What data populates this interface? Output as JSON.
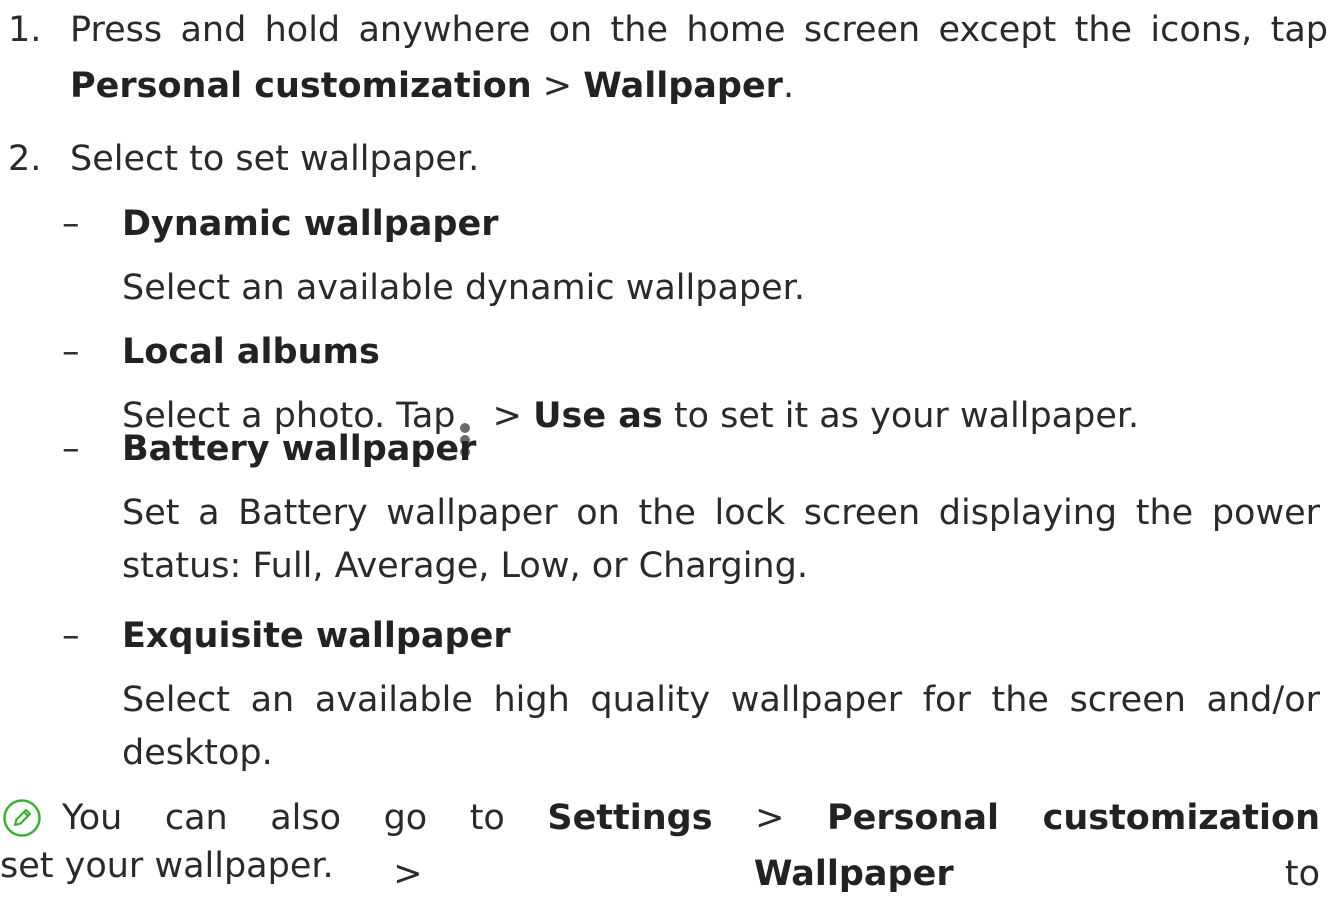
{
  "step1": {
    "number": "1.",
    "line1": "Press and hold anywhere on the home screen except the icons, tap",
    "bold_a": "Personal customization",
    "sep": " > ",
    "bold_b": "Wallpaper",
    "end": "."
  },
  "step2": {
    "number": "2.",
    "text": "Select to set wallpaper."
  },
  "options": [
    {
      "dash": "–",
      "title": "Dynamic wallpaper",
      "desc": "Select an available dynamic wallpaper."
    },
    {
      "dash": "–",
      "title": "Local albums",
      "desc_a": "Select a photo. Tap",
      "desc_sep": " > ",
      "desc_bold": "Use as",
      "desc_b": " to set it as your wallpaper."
    },
    {
      "dash": "–",
      "title": "Battery wallpaper",
      "desc_line1": "Set a Battery wallpaper on the lock screen displaying the power",
      "desc_line2": "status: Full, Average, Low, or Charging."
    },
    {
      "dash": "–",
      "title": "Exquisite wallpaper",
      "desc_line1": "Select an available high quality wallpaper for the screen and/or",
      "desc_line2": "desktop."
    }
  ],
  "note": {
    "text_a": "You can also go to ",
    "bold_a": "Settings",
    "sep1": " > ",
    "bold_b": "Personal customization",
    "sep2": " > ",
    "bold_c": "Wallpaper",
    "text_b": " to",
    "line2": "set your wallpaper."
  },
  "icons": {
    "note": "note-pencil-icon",
    "menu": "more-vertical-icon"
  },
  "colors": {
    "text": "#2a2a2a",
    "note_icon": "#3cb034",
    "menu_icon": "#6a6a6a"
  }
}
